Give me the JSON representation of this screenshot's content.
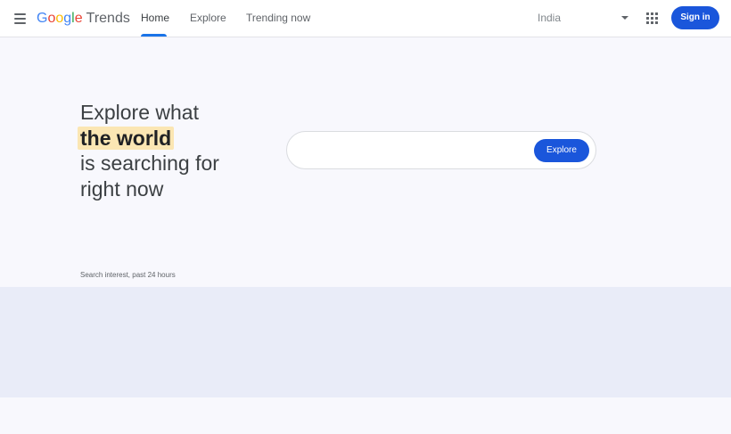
{
  "header": {
    "logo": {
      "google": "Google",
      "product": "Trends"
    },
    "tabs": [
      {
        "label": "Home",
        "active": true
      },
      {
        "label": "Explore",
        "active": false
      },
      {
        "label": "Trending now",
        "active": false
      }
    ],
    "country": "India",
    "signin_label": "Sign in"
  },
  "hero": {
    "line1": "Explore what",
    "line2": "the world",
    "line3": "is searching for",
    "line4": "right now"
  },
  "search": {
    "value": "",
    "placeholder": "",
    "button_label": "Explore"
  },
  "caption": "Search interest, past 24 hours",
  "colors": {
    "accent": "#1a56db",
    "highlight": "#fbe6b3",
    "map_band": "#e9ecf8",
    "page_bg": "#f8f8fd"
  },
  "icons": [
    "menu-icon",
    "apps-grid-icon",
    "dropdown-caret-icon"
  ]
}
